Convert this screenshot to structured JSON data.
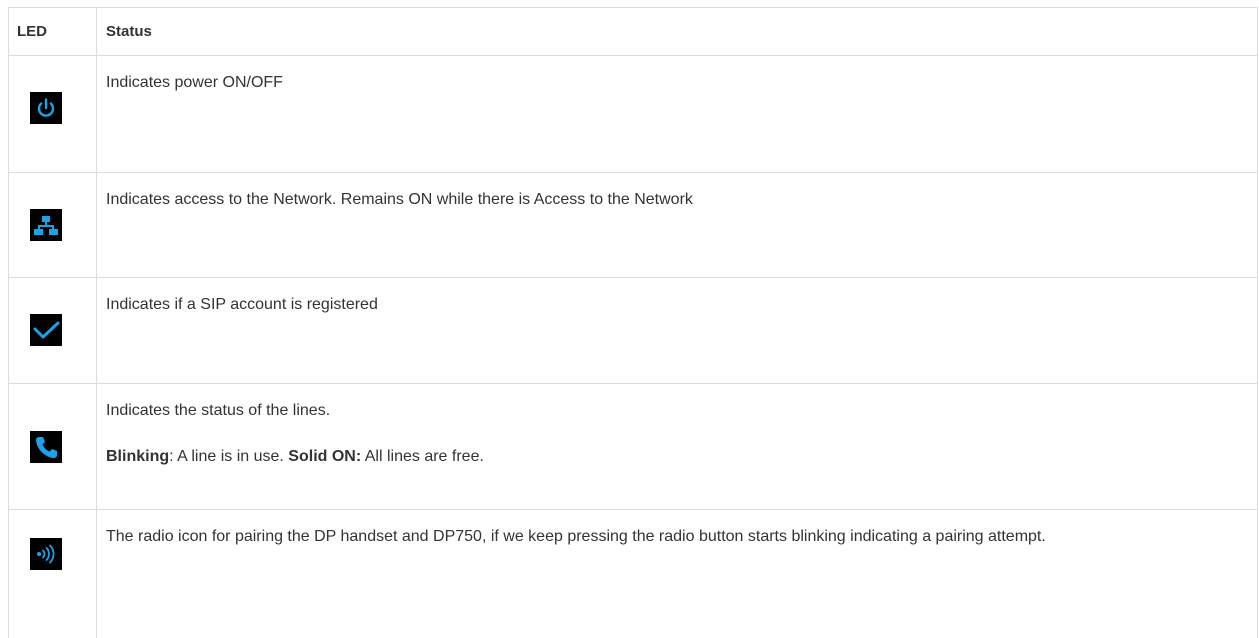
{
  "table": {
    "headers": {
      "led": "LED",
      "status": "Status"
    },
    "accent_color": "#1aa3e8",
    "rows": [
      {
        "icon": "power-icon",
        "text": "Indicates power ON/OFF"
      },
      {
        "icon": "network-icon",
        "text": "Indicates access to the Network. Remains ON while there is Access to the Network"
      },
      {
        "icon": "checkmark-icon",
        "text": "Indicates if a SIP account is registered"
      },
      {
        "icon": "phone-icon",
        "text": "Indicates the status of the lines.",
        "blinking_label": "Blinking",
        "blinking_text": ": A line is in use. ",
        "solid_label": "Solid ON:",
        "solid_text": " All lines are free."
      },
      {
        "icon": "radio-icon",
        "text": "The radio icon for pairing the DP handset and DP750, if we keep pressing the radio button starts blinking indicating a pairing attempt."
      }
    ]
  }
}
